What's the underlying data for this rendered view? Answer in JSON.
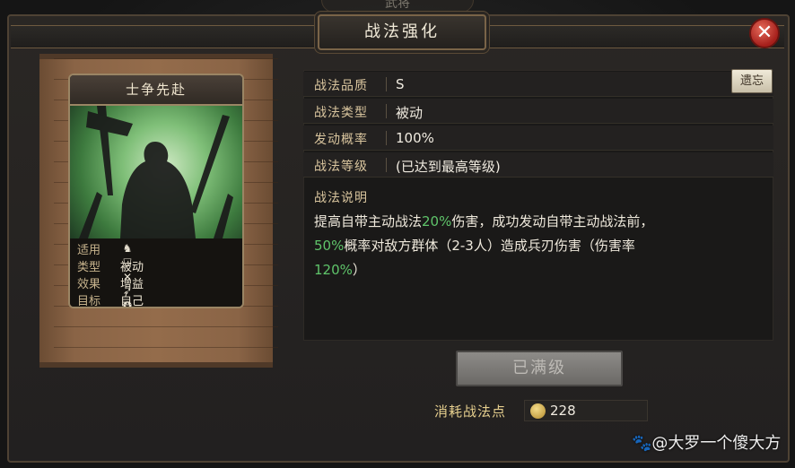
{
  "background_tab": {
    "label": "武将"
  },
  "dialog": {
    "title": "战法强化",
    "close_icon": "✕"
  },
  "skill_card": {
    "name": "士争先赴",
    "stats": [
      {
        "key": "适用",
        "value": ""
      },
      {
        "key": "类型",
        "value": "被动"
      },
      {
        "key": "效果",
        "value": "增益"
      },
      {
        "key": "目标",
        "value": "自己"
      }
    ],
    "applies_icons": [
      "cavalry-icon",
      "shield-icon",
      "crossbow-icon",
      "spear-icon",
      "vehicle-icon"
    ]
  },
  "info": {
    "rows": [
      {
        "key": "战法品质",
        "value": "S"
      },
      {
        "key": "战法类型",
        "value": "被动"
      },
      {
        "key": "发动概率",
        "value": "100%"
      },
      {
        "key": "战法等级",
        "value": "(已达到最高等级)"
      }
    ],
    "switch_button": "遗忘"
  },
  "description": {
    "title": "战法说明",
    "line1_a": "提高自带主动战法",
    "line1_pct": "20%",
    "line1_b": "伤害，成功发动自带主动战法前，",
    "line2_pct": "50%",
    "line2_b": "概率对敌方群体（2-3人）造成兵刃伤害（伤害率",
    "line3_pct": "120%",
    "line3_b": "）"
  },
  "actions": {
    "maxed_label": "已满级"
  },
  "cost": {
    "label": "消耗战法点",
    "value": "228"
  },
  "watermark": {
    "text": "🐾@大罗一个傻大方"
  },
  "colors": {
    "highlight": "#5fc46a",
    "gold": "#d9c59e",
    "close": "#c0302a"
  }
}
